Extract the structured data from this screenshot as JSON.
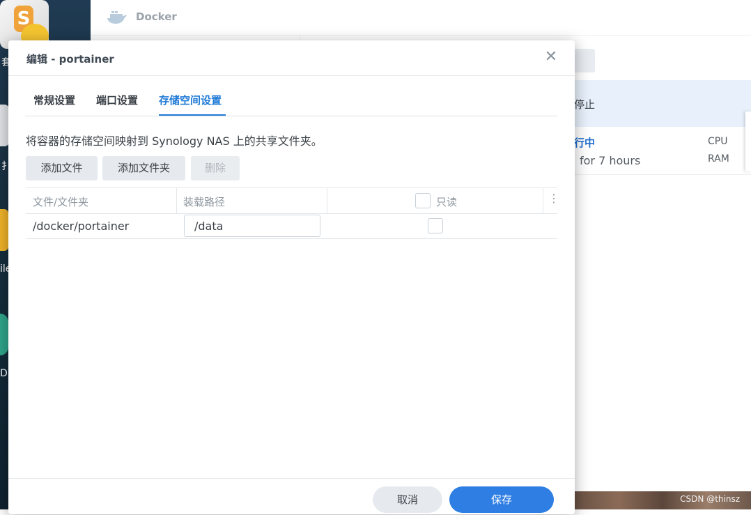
{
  "desktop": {
    "label_1": "套",
    "label_2": "扌",
    "label_3": "ile",
    "label_4": "D:"
  },
  "docker_window": {
    "title": "Docker",
    "status_stopped": "停止",
    "status_running": "行中",
    "uptime": "for 7 hours",
    "cpu_label": "CPU",
    "ram_label": "RAM"
  },
  "dialog": {
    "title": "编辑 - portainer",
    "close_symbol": "✕",
    "tabs": [
      {
        "label": "常规设置"
      },
      {
        "label": "端口设置"
      },
      {
        "label": "存储空间设置"
      }
    ],
    "description": "将容器的存储空间映射到 Synology NAS 上的共享文件夹。",
    "buttons": {
      "add_file": "添加文件",
      "add_folder": "添加文件夹",
      "delete": "删除"
    },
    "table": {
      "headers": {
        "file_folder": "文件/文件夹",
        "mount_path": "装载路径",
        "readonly": "只读"
      },
      "rows": [
        {
          "file_folder": "/docker/portainer",
          "mount_path": "/data",
          "readonly": false
        }
      ]
    },
    "footer": {
      "cancel": "取消",
      "save": "保存"
    }
  },
  "watermark": "CSDN @thinsz",
  "colors": {
    "accent": "#1f7ad6",
    "save_button": "#2e7ee3",
    "selected_row": "#e7f0fb"
  }
}
